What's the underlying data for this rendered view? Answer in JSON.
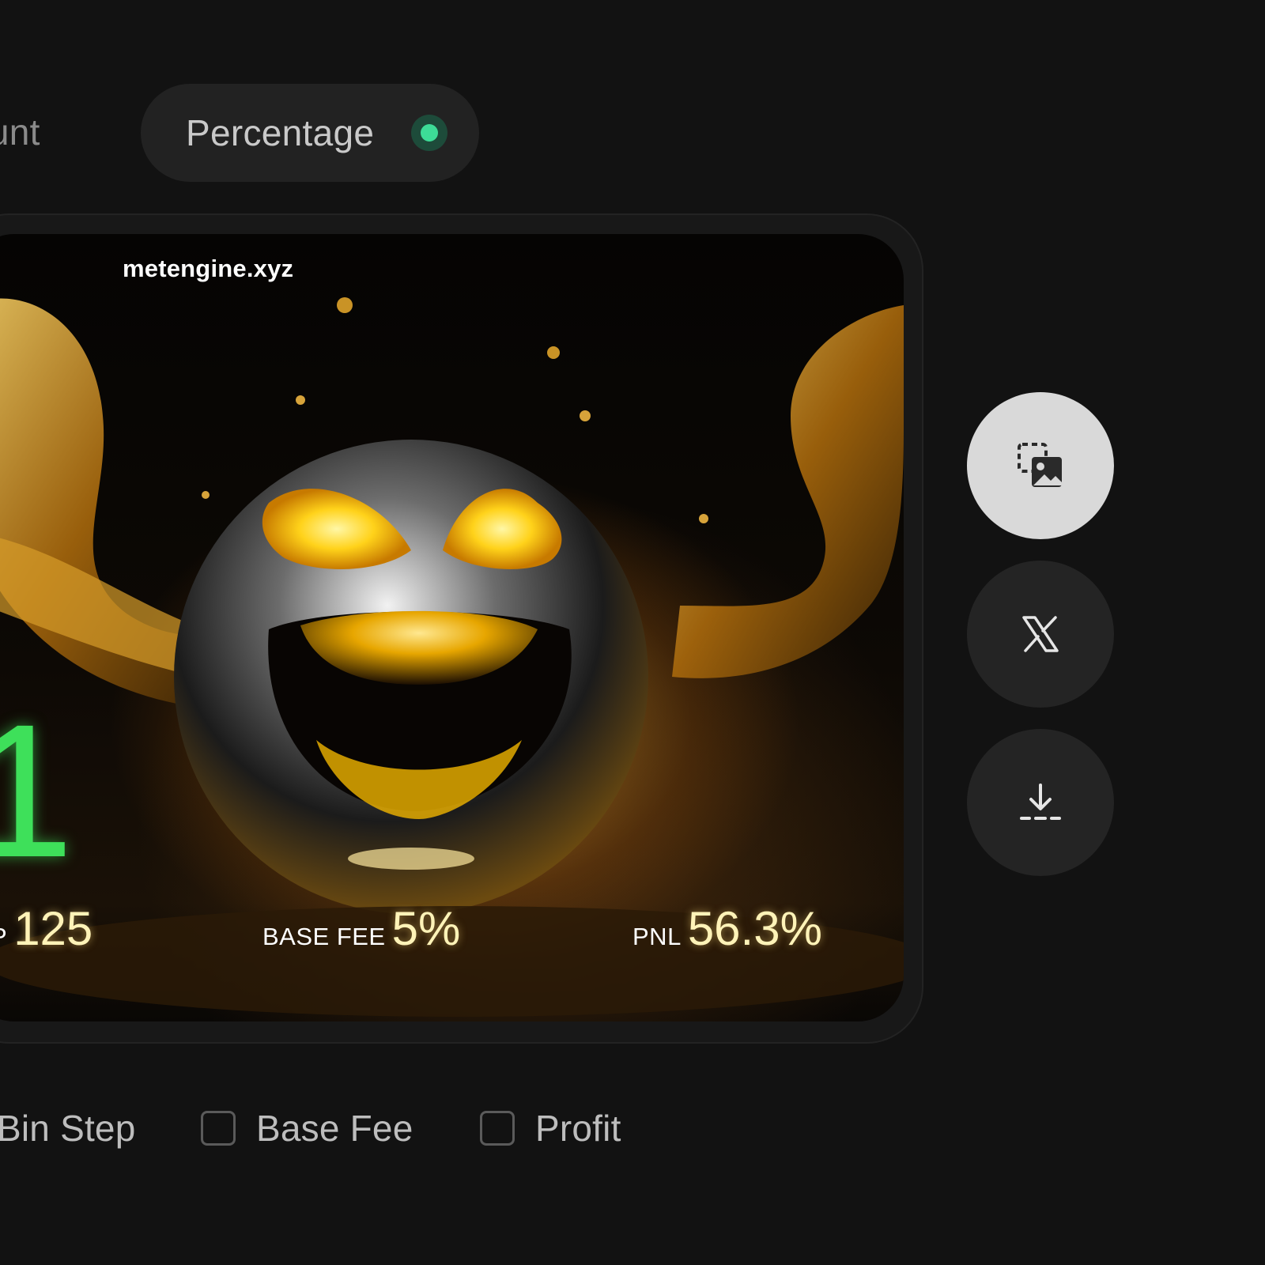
{
  "mode_toggle": {
    "amount_label": "ount",
    "percentage_label": "Percentage",
    "selected": "Percentage",
    "accent_color": "#3ddc97"
  },
  "card": {
    "brand": "metengine.xyz",
    "headline_value": "1",
    "headline_color": "#3ee05a",
    "stats": {
      "bin_step_label": "P",
      "bin_step_value": "125",
      "base_fee_label": "BASE FEE",
      "base_fee_value": "5%",
      "pnl_label": "PNL",
      "pnl_value": "56.3%"
    }
  },
  "actions": {
    "copy_icon": "copy-image-icon",
    "share_icon": "x-logo-icon",
    "download_icon": "download-icon"
  },
  "options": [
    {
      "label": "Bin Step",
      "checked": false
    },
    {
      "label": "Base Fee",
      "checked": false
    },
    {
      "label": "Profit",
      "checked": false
    }
  ]
}
